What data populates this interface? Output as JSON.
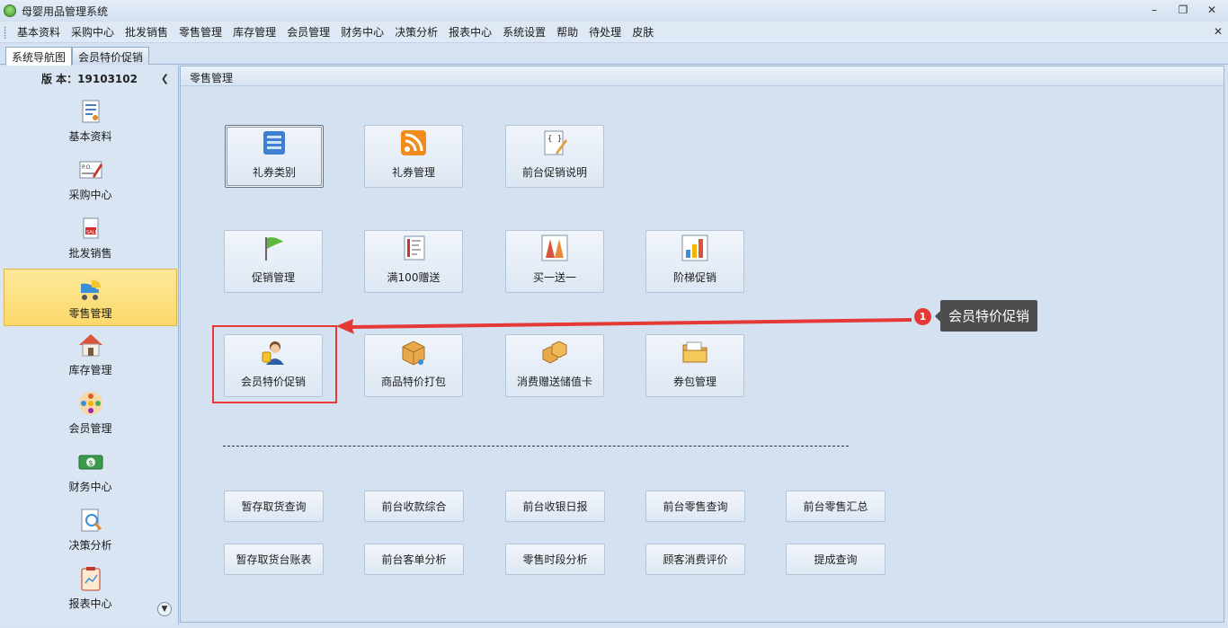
{
  "window": {
    "title": "母婴用品管理系统"
  },
  "menu": [
    "基本资料",
    "采购中心",
    "批发销售",
    "零售管理",
    "库存管理",
    "会员管理",
    "财务中心",
    "决策分析",
    "报表中心",
    "系统设置",
    "帮助",
    "待处理",
    "皮肤"
  ],
  "tabs": [
    "系统导航图",
    "会员特价促销"
  ],
  "sidebar": {
    "version": "版 本：19103102",
    "items": [
      {
        "label": "基本资料",
        "icon": "document-icon"
      },
      {
        "label": "采购中心",
        "icon": "purchase-order-icon"
      },
      {
        "label": "批发销售",
        "icon": "sale-tag-icon"
      },
      {
        "label": "零售管理",
        "icon": "baby-stroller-icon"
      },
      {
        "label": "库存管理",
        "icon": "warehouse-house-icon"
      },
      {
        "label": "会员管理",
        "icon": "members-icon"
      },
      {
        "label": "财务中心",
        "icon": "money-icon"
      },
      {
        "label": "决策分析",
        "icon": "analysis-icon"
      },
      {
        "label": "报表中心",
        "icon": "report-icon"
      }
    ],
    "selected_index": 3
  },
  "main": {
    "header": "零售管理",
    "tiles": [
      {
        "label": "礼券类别",
        "icon": "list-icon"
      },
      {
        "label": "礼券管理",
        "icon": "rss-icon"
      },
      {
        "label": "前台促销说明",
        "icon": "edit-document-icon"
      },
      {
        "label": "促销管理",
        "icon": "flag-icon"
      },
      {
        "label": "满100赠送",
        "icon": "ruler-chart-icon"
      },
      {
        "label": "买一送一",
        "icon": "cones-icon"
      },
      {
        "label": "阶梯促销",
        "icon": "bar-chart-icon"
      },
      {
        "label": "会员特价促销",
        "icon": "member-user-icon"
      },
      {
        "label": "商品特价打包",
        "icon": "package-cart-icon"
      },
      {
        "label": "消费赠送储值卡",
        "icon": "boxes-icon"
      },
      {
        "label": "券包管理",
        "icon": "folder-icon"
      }
    ],
    "buttons_row1": [
      "暂存取货查询",
      "前台收款综合",
      "前台收银日报",
      "前台零售查询",
      "前台零售汇总"
    ],
    "buttons_row2": [
      "暂存取货台账表",
      "前台客单分析",
      "零售时段分析",
      "顾客消费评价",
      "提成查询"
    ]
  },
  "annotation": {
    "badge": "1",
    "callout": "会员特价促销"
  },
  "colors": {
    "accent_red": "#e53935",
    "selected_nav": "#fcd96a",
    "panel_bg": "#d4e1f1"
  }
}
